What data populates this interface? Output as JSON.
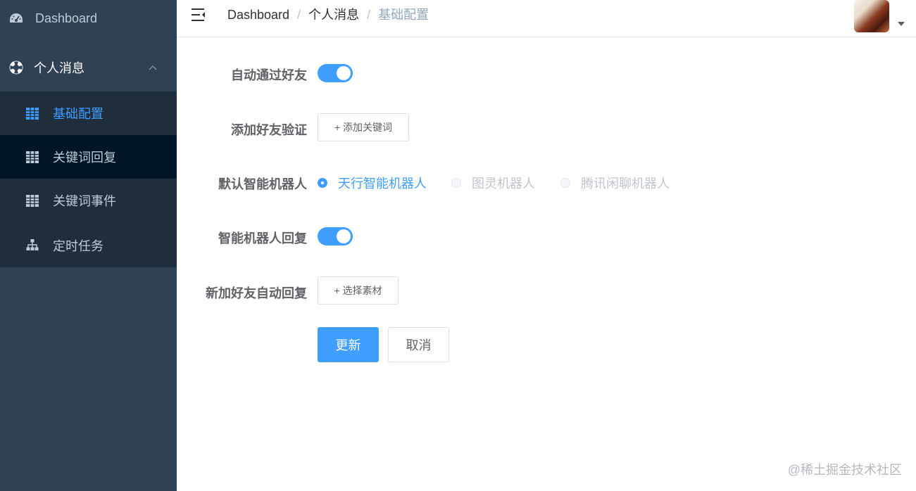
{
  "sidebar": {
    "dashboard": "Dashboard",
    "group": "个人消息",
    "items": [
      {
        "label": "基础配置"
      },
      {
        "label": "关键词回复"
      },
      {
        "label": "关键词事件"
      },
      {
        "label": "定时任务"
      }
    ]
  },
  "breadcrumb": [
    "Dashboard",
    "个人消息",
    "基础配置"
  ],
  "breadcrumb_separator": "/",
  "form": {
    "auto_accept_label": "自动通过好友",
    "auto_accept_on": true,
    "verify_label": "添加好友验证",
    "add_keyword_button": "+ 添加关键词",
    "robot_label": "默认智能机器人",
    "robot_options": [
      "天行智能机器人",
      "图灵机器人",
      "腾讯闲聊机器人"
    ],
    "robot_selected": "天行智能机器人",
    "robot_reply_label": "智能机器人回复",
    "robot_reply_on": true,
    "new_friend_label": "新加好友自动回复",
    "select_material_button": "+ 选择素材",
    "update_button": "更新",
    "cancel_button": "取消"
  },
  "watermark": "@稀土掘金技术社区",
  "colors": {
    "primary": "#409eff",
    "sidebar": "#304156",
    "submenu": "#1f2d3d",
    "active_text": "#409eff"
  }
}
